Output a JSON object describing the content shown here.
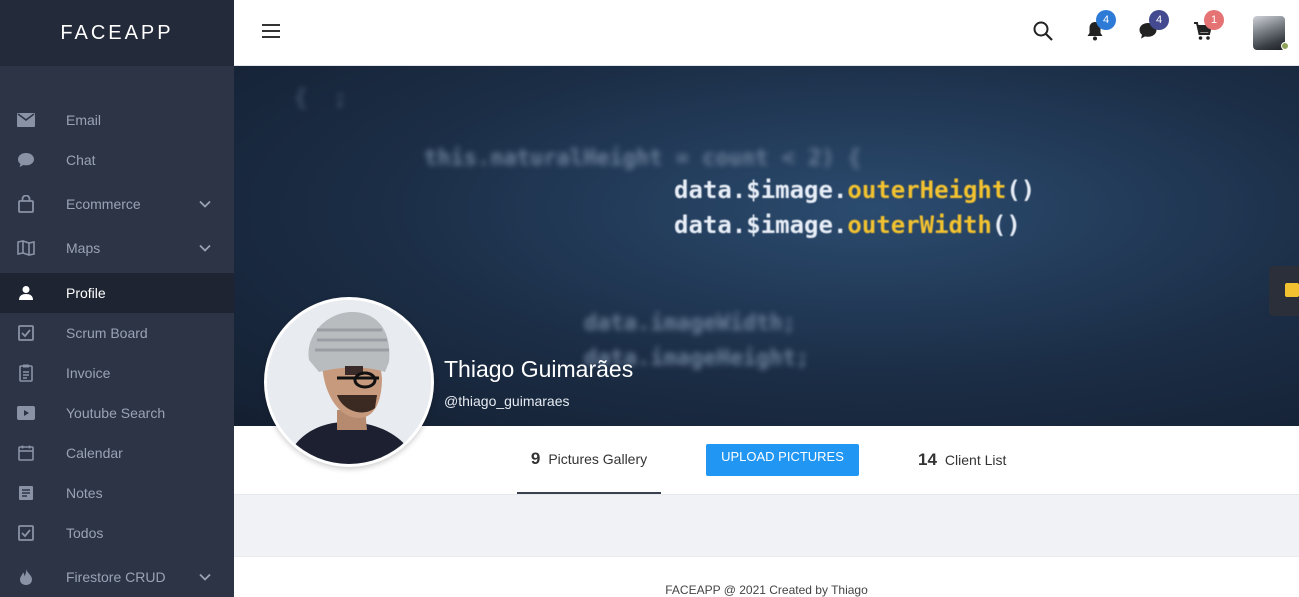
{
  "app": {
    "brand": "FACEAPP"
  },
  "sidebar": {
    "items": [
      {
        "label": "Email",
        "icon": "email-icon",
        "has_submenu": false
      },
      {
        "label": "Chat",
        "icon": "chat-icon",
        "has_submenu": false
      },
      {
        "label": "Ecommerce",
        "icon": "shopping-bag-icon",
        "has_submenu": true
      },
      {
        "label": "Maps",
        "icon": "map-icon",
        "has_submenu": true
      },
      {
        "label": "Profile",
        "icon": "user-icon",
        "has_submenu": false,
        "active": true
      },
      {
        "label": "Scrum Board",
        "icon": "checkbox-icon",
        "has_submenu": false
      },
      {
        "label": "Invoice",
        "icon": "clipboard-icon",
        "has_submenu": false
      },
      {
        "label": "Youtube Search",
        "icon": "youtube-icon",
        "has_submenu": false
      },
      {
        "label": "Calendar",
        "icon": "calendar-icon",
        "has_submenu": false
      },
      {
        "label": "Notes",
        "icon": "notes-icon",
        "has_submenu": false
      },
      {
        "label": "Todos",
        "icon": "checkbox-icon",
        "has_submenu": false
      },
      {
        "label": "Firestore CRUD",
        "icon": "fire-icon",
        "has_submenu": true
      }
    ]
  },
  "header": {
    "notifications_count": "4",
    "messages_count": "4",
    "cart_count": "1",
    "colors": {
      "notifications_badge": "#2d7bd6",
      "messages_badge": "#434a8f",
      "cart_badge": "#e57373"
    }
  },
  "profile": {
    "name": "Thiago Guimarães",
    "handle": "@thiago_guimaraes",
    "pictures_count": "9",
    "pictures_label": "Pictures Gallery",
    "upload_label": "UPLOAD PICTURES",
    "clients_count": "14",
    "clients_label": "Client List"
  },
  "cover_code": {
    "line1": "this.naturalHeight = count < 2) {",
    "line2": "data.$image.outerHeight()",
    "line3": "data.$image.outerWidth()",
    "line4": "data.imageWidth;",
    "line5": "data.imageHeight;"
  },
  "footer": {
    "text": "FACEAPP @ 2021 Created by Thiago"
  },
  "colors": {
    "sidebar": "#2c3446",
    "brand_bar": "#232a39",
    "accent": "#2196f3"
  }
}
